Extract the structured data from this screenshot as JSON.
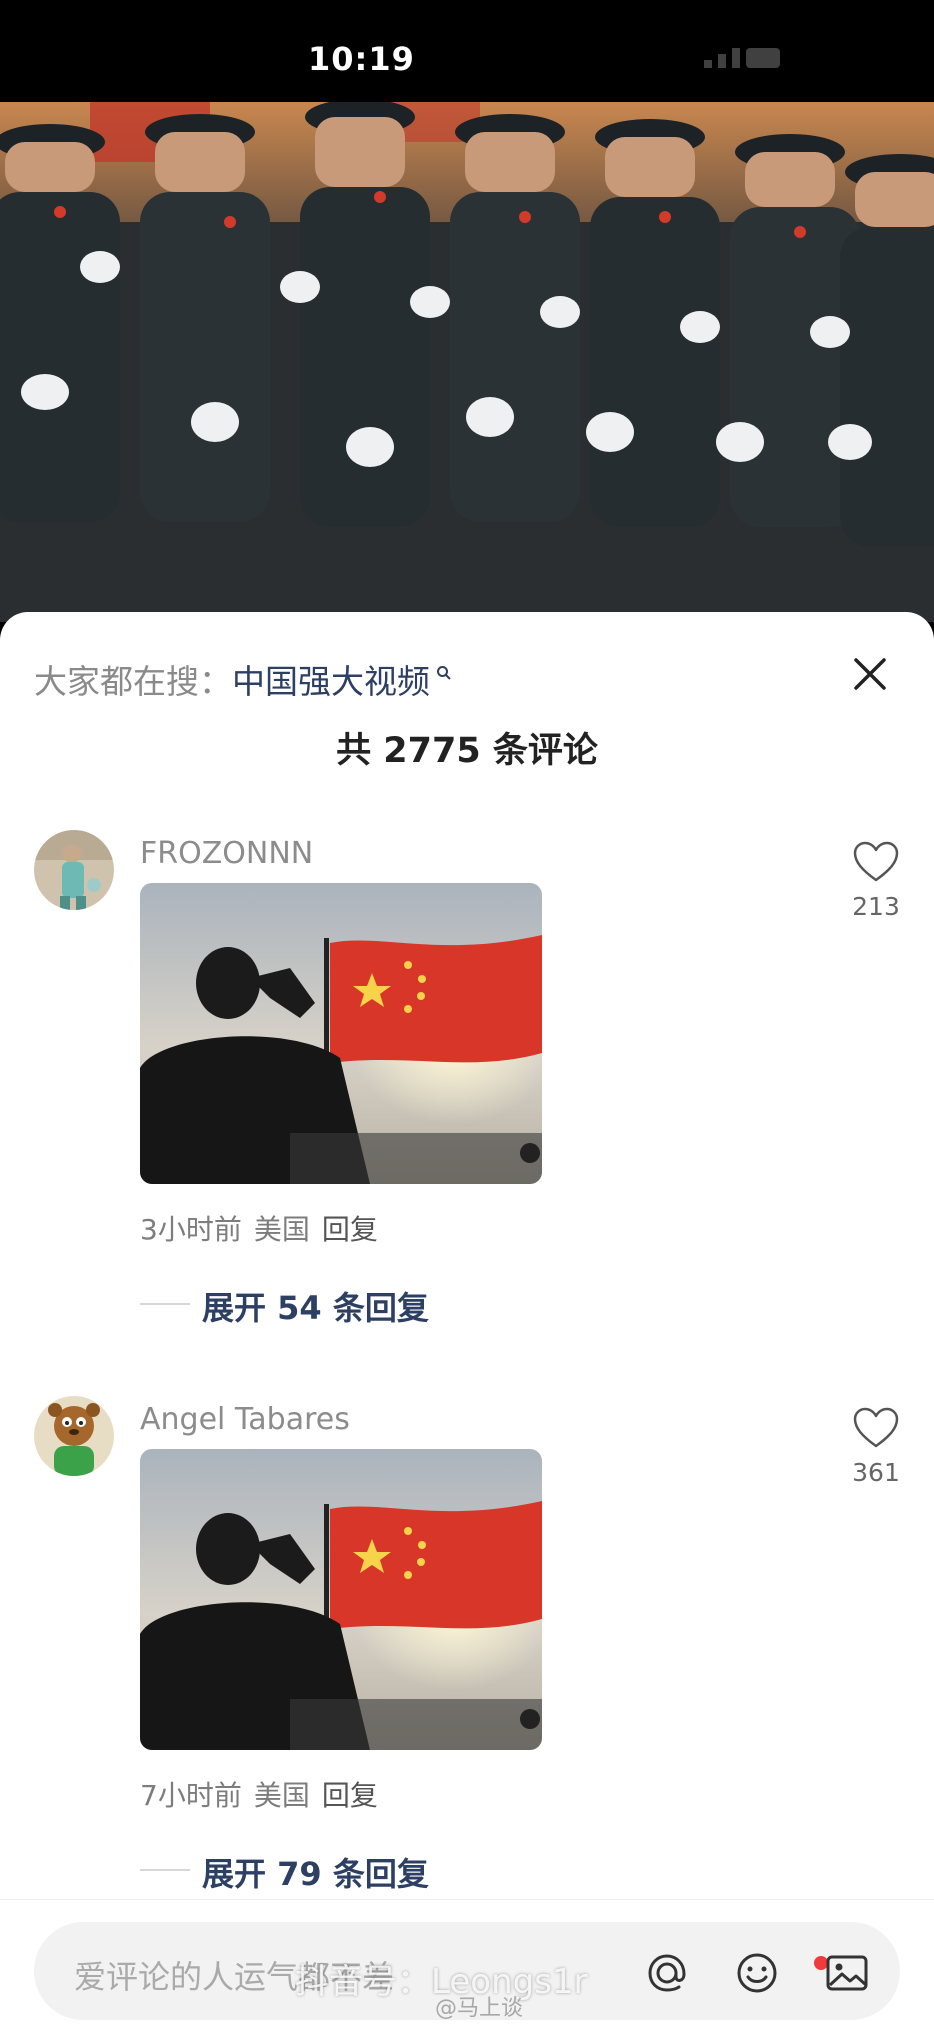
{
  "status_bar": {
    "time": "10:19"
  },
  "video": {
    "description_icon": "soldiers-marching-image"
  },
  "sheet": {
    "search_hint_prefix": "大家都在搜：",
    "search_keyword": "中国强大视频",
    "search_sup_icon": "search-icon",
    "comment_count_label": "共 2775 条评论",
    "close_icon": "close-icon"
  },
  "comments": [
    {
      "username": "FROZONNN",
      "time": "3小时前",
      "location": "美国",
      "reply_label": "回复",
      "expand_label": "展开 54 条回复",
      "likes": "213",
      "image_icon": "flag-salute-image"
    },
    {
      "username": "Angel Tabares",
      "time": "7小时前",
      "location": "美国",
      "reply_label": "回复",
      "expand_label": "展开 79 条回复",
      "likes": "361",
      "image_icon": "flag-salute-image"
    }
  ],
  "input_bar": {
    "placeholder": "爱评论的人运气都不差",
    "icons": [
      "at-icon",
      "emoji-icon",
      "image-icon"
    ]
  },
  "watermark": {
    "text1": "抖音号：Leongs1r",
    "text2": "@马上谈"
  }
}
